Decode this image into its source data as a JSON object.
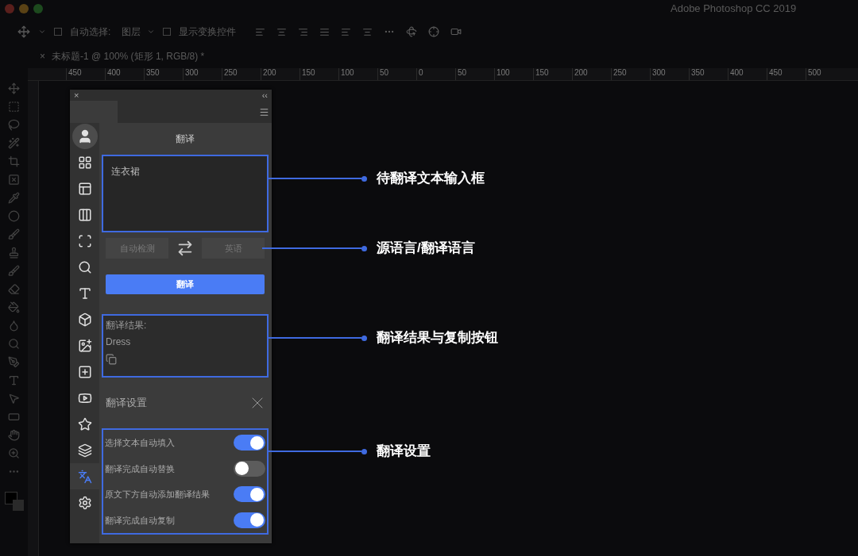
{
  "window": {
    "title": "Adobe Photoshop CC 2019"
  },
  "options_bar": {
    "auto_select_label": "自动选择:",
    "auto_select_checked": false,
    "auto_select_value": "图层",
    "show_transform_label": "显示变换控件",
    "show_transform_checked": false
  },
  "document_tab": {
    "close": "×",
    "title": "未标题-1 @ 100% (矩形 1, RGB/8) *"
  },
  "ruler": {
    "ticks": [
      "450",
      "400",
      "350",
      "300",
      "250",
      "200",
      "150",
      "100",
      "50",
      "0",
      "50",
      "100",
      "150",
      "200",
      "250",
      "300",
      "350",
      "400",
      "450",
      "500"
    ]
  },
  "panel": {
    "close": "×",
    "collapse": "‹‹",
    "side_items": [
      {
        "kind": "avatar",
        "selected": false
      },
      {
        "kind": "grid",
        "selected": false
      },
      {
        "kind": "layout",
        "selected": false
      },
      {
        "kind": "columns",
        "selected": false
      },
      {
        "kind": "frame",
        "selected": false
      },
      {
        "kind": "font-search",
        "selected": false
      },
      {
        "kind": "text",
        "selected": false
      },
      {
        "kind": "cube",
        "selected": false
      },
      {
        "kind": "image-edit",
        "selected": false
      },
      {
        "kind": "add",
        "selected": false
      },
      {
        "kind": "play",
        "selected": false
      },
      {
        "kind": "star",
        "selected": false
      },
      {
        "kind": "layers",
        "selected": false
      },
      {
        "kind": "translate",
        "selected": true
      },
      {
        "kind": "settings",
        "selected": false
      }
    ],
    "title": "翻译",
    "input": {
      "value": "连衣裙"
    },
    "source_language": "自动检测",
    "target_language": "英语",
    "translate_button": "翻译",
    "result": {
      "label": "翻译结果:",
      "text": "Dress"
    },
    "settings": {
      "title": "翻译设置",
      "options": [
        {
          "label": "选择文本自动填入",
          "on": true
        },
        {
          "label": "翻译完成自动替换",
          "on": false
        },
        {
          "label": "原文下方自动添加翻译结果",
          "on": true
        },
        {
          "label": "翻译完成自动复制",
          "on": true
        }
      ]
    }
  },
  "annotations": [
    {
      "label": "待翻译文本输入框"
    },
    {
      "label": "源语言/翻译语言"
    },
    {
      "label": "翻译结果与复制按钮"
    },
    {
      "label": "翻译设置"
    }
  ]
}
